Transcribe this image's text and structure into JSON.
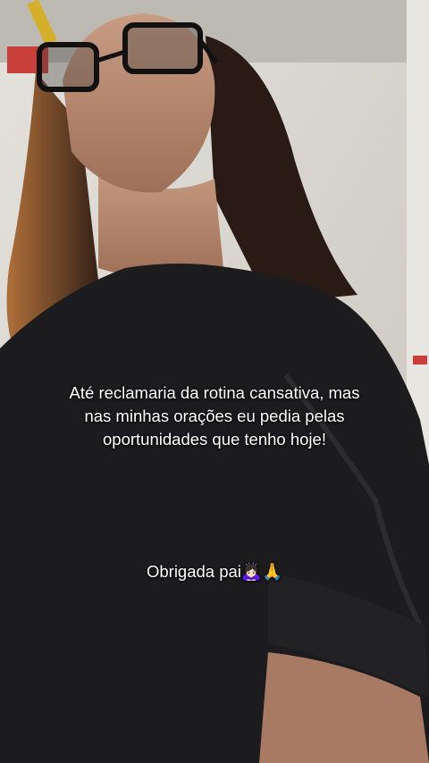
{
  "captions": {
    "main": "Até reclamaria da rotina cansativa, mas\nnas minhas orações eu pedia pelas\noportunidades que tenho hoje!",
    "thanks": "Obrigada pai🙇🏻‍♀️🙏"
  },
  "colors": {
    "sweater": "#1c1c1e",
    "skin": "#b78a70",
    "hair": "#2a1a14",
    "wall": "#d9d6cf",
    "ceiling": "#c9c6c0"
  }
}
